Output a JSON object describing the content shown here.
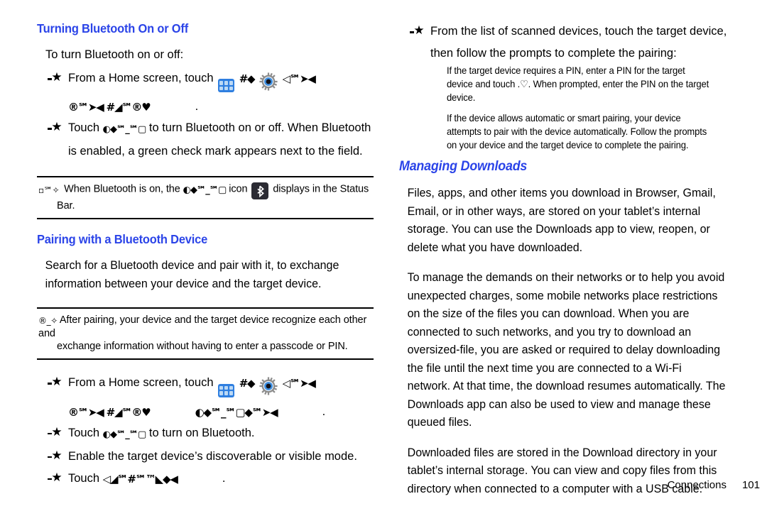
{
  "page": {
    "footer_section": "Connections",
    "footer_page_number": "101",
    "heading_color": "#2b44e8"
  },
  "left_column": {
    "heading_bluetooth_onoff": "Turning Bluetooth On or Off",
    "lead_onoff": "To turn Bluetooth on or off:",
    "bullet1": {
      "text_before_icon": "From a Home screen, touch",
      "apps_icon": "apps-grid-icon",
      "glyph_run_1": "#◆",
      "gear_icon": "settings-gear-icon",
      "glyph_run_2": "◁℠➤◀",
      "glyph_run_3": "®℠➤◀ #◢℠®♥",
      "trailing_period": "."
    },
    "bullet2": {
      "text_before": "Touch",
      "glyph_run": "◐◆℠_℠▢",
      "text_after": "to turn Bluetooth on or off. When Bluetooth",
      "line2": "is enabled, a green check mark appears next to the field."
    },
    "note1": {
      "glyph_prefix": "▫℠✧",
      "text_part1": "When Bluetooth is on, the",
      "glyph_token": "◐◆℠_℠▢",
      "text_part2": "icon",
      "bluetooth_icon": "bluetooth-status-icon",
      "text_part3": "displays in the Status",
      "line2": "Bar."
    },
    "heading_pairing": "Pairing with a Bluetooth Device",
    "pairing_para": "Search for a Bluetooth device and pair with it, to exchange information between your device and the target device.",
    "note2": {
      "glyph_prefix": "®_✧",
      "text": "After pairing, your device and the target device recognize each other and",
      "line2": "exchange information without having to enter a passcode or PIN."
    },
    "bullet3": {
      "text_before_icon": "From a Home screen, touch",
      "apps_icon": "apps-grid-icon",
      "glyph_run_1": "#◆",
      "gear_icon": "settings-gear-icon",
      "glyph_run_2": "◁℠➤◀",
      "glyph_run_3": "®℠➤◀ #◢℠®♥",
      "glyph_run_4": "◐◆℠_℠▢◆℠➤◀",
      "trailing_period": "."
    },
    "bullet4": {
      "text_before": "Touch",
      "glyph_run": "◐◆℠_℠▢",
      "text_after": "to turn on Bluetooth."
    },
    "bullet5": {
      "text": "Enable the target device’s discoverable or visible mode."
    },
    "bullet6": {
      "text_before": "Touch",
      "glyph_run": "◁◢℠#℠™◣◆◀",
      "trailing_period": "."
    }
  },
  "right_column": {
    "bullet1": {
      "line1": "From the list of scanned devices, touch the target device,",
      "line2": "then follow the prompts to complete the pairing:"
    },
    "subpara1": "If the target device requires a PIN, enter a PIN for the target device and touch .♡. When prompted, enter the PIN on the target device.",
    "subpara2": "If the device allows automatic or smart pairing, your device attempts to pair with the device automatically. Follow the prompts on your device and the target device to complete the pairing.",
    "heading_managing_downloads": "Managing Downloads",
    "para1": "Files, apps, and other items you download in Browser, Gmail, Email, or in other ways, are stored on your tablet’s internal storage. You can use the Downloads app to view, reopen, or delete what you have downloaded.",
    "para2": "To manage the demands on their networks or to help you avoid unexpected charges, some mobile networks place restrictions on the size of the files you can download. When you are connected to such networks, and you try to download an oversized-file, you are asked or required to delay downloading the file until the next time you are connected to a Wi-Fi network. At that time, the download resumes automatically. The Downloads app can also be used to view and manage these queued files.",
    "para3": "Downloaded files are stored in the Download directory in your tablet’s internal storage. You can view and copy files from this directory when connected to a computer with a USB cable."
  }
}
